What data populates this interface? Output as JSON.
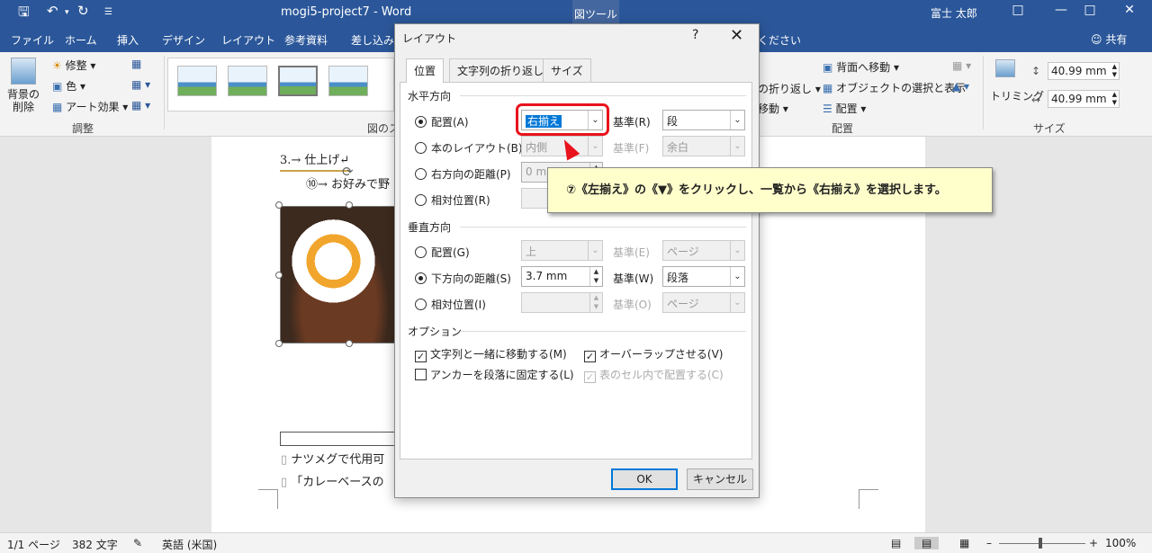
{
  "titlebar": {
    "doc_title": "mogi5-project7 - Word",
    "context_tool": "図ツール",
    "user": "富士 太郎"
  },
  "ribbon_tabs": [
    "ファイル",
    "ホーム",
    "挿入",
    "デザイン",
    "レイアウト",
    "参考資料",
    "差し込み",
    "ください"
  ],
  "share_label": "共有",
  "ribbon": {
    "remove_bg": "背景の削除",
    "corrections": "修整",
    "color": "色",
    "artistic": "アート効果",
    "adjust_group": "調整",
    "style_group": "図のス",
    "wrap_text": "の折り返し",
    "move": "移動",
    "send_back": "背面へ移動",
    "selection_pane": "オブジェクトの選択と表示",
    "align": "配置",
    "arrange_group": "配置",
    "crop": "トリミング",
    "height": "40.99 mm",
    "width": "40.99 mm",
    "size_group": "サイズ"
  },
  "document": {
    "heading": "3.→ 仕上げ↵",
    "step": "⑩→ お好みで野",
    "line1": "ナツメグで代用可",
    "line2": "「カレーベースの"
  },
  "statusbar": {
    "page": "1/1 ページ",
    "words": "382 文字",
    "lang": "英語 (米国)",
    "zoom": "100%"
  },
  "dialog": {
    "title": "レイアウト",
    "help": "?",
    "tabs": [
      "位置",
      "文字列の折り返し",
      "サイズ"
    ],
    "horizontal": {
      "section": "水平方向",
      "rows": [
        {
          "label": "配置(A)",
          "value": "右揃え",
          "base_label": "基準(R)",
          "base_value": "段",
          "selected": true
        },
        {
          "label": "本のレイアウト(B)",
          "value": "内側",
          "base_label": "基準(F)",
          "base_value": "余白",
          "selected": false
        },
        {
          "label": "右方向の距離(P)",
          "value": "0 mm",
          "selected": false
        },
        {
          "label": "相対位置(R)",
          "value": "",
          "selected": false
        }
      ]
    },
    "vertical": {
      "section": "垂直方向",
      "rows": [
        {
          "label": "配置(G)",
          "value": "上",
          "base_label": "基準(E)",
          "base_value": "ページ",
          "selected": false
        },
        {
          "label": "下方向の距離(S)",
          "value": "3.7 mm",
          "base_label": "基準(W)",
          "base_value": "段落",
          "selected": true
        },
        {
          "label": "相対位置(I)",
          "value": "",
          "base_label": "基準(O)",
          "base_value": "ページ",
          "selected": false
        }
      ]
    },
    "options": {
      "section": "オプション",
      "move_with_text": "文字列と一緒に移動する(M)",
      "allow_overlap": "オーバーラップさせる(V)",
      "lock_anchor": "アンカーを段落に固定する(L)",
      "layout_in_cell": "表のセル内で配置する(C)"
    },
    "ok": "OK",
    "cancel": "キャンセル"
  },
  "callout": "⑦《左揃え》の《▼》をクリックし、一覧から《右揃え》を選択します。"
}
